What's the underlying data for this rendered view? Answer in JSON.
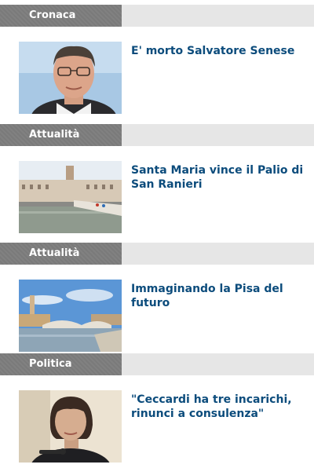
{
  "articles": [
    {
      "category": "Cronaca",
      "title": "E' morto Salvatore Senese",
      "image": "portrait-man-glasses"
    },
    {
      "category": "Attualità",
      "title": "Santa Maria vince il Palio di San Ranieri",
      "image": "river-palio-city"
    },
    {
      "category": "Attualità",
      "title": "Immaginando la Pisa del futuro",
      "image": "river-bridge-tower"
    },
    {
      "category": "Politica",
      "title": "\"Ceccardi ha tre incarichi, rinunci a consulenza\"",
      "image": "portrait-woman-microphone"
    }
  ],
  "colors": {
    "category_tab": "#7a7a7a",
    "category_bar": "#e6e6e6",
    "headline": "#0c4c7c",
    "background": "#ffffff"
  }
}
